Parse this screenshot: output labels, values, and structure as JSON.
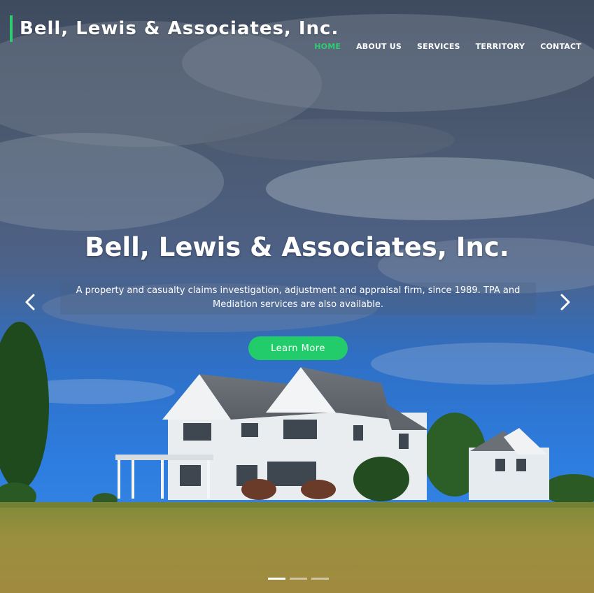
{
  "header": {
    "brand": "Bell, Lewis & Associates, Inc.",
    "accent_color": "#2ecc71",
    "nav": [
      {
        "label": "HOME",
        "active": true
      },
      {
        "label": "ABOUT US",
        "active": false
      },
      {
        "label": "SERVICES",
        "active": false
      },
      {
        "label": "TERRITORY",
        "active": false
      },
      {
        "label": "CONTACT",
        "active": false
      }
    ]
  },
  "hero": {
    "title": "Bell, Lewis & Associates, Inc.",
    "subtitle": "A property and casualty claims investigation, adjustment and appraisal firm, since 1989. TPA and Mediation services are also available.",
    "cta_label": "Learn More",
    "cta_color": "#22cc6b",
    "prev_icon": "chevron-left-icon",
    "next_icon": "chevron-right-icon",
    "slides": 3,
    "active_slide": 1
  }
}
